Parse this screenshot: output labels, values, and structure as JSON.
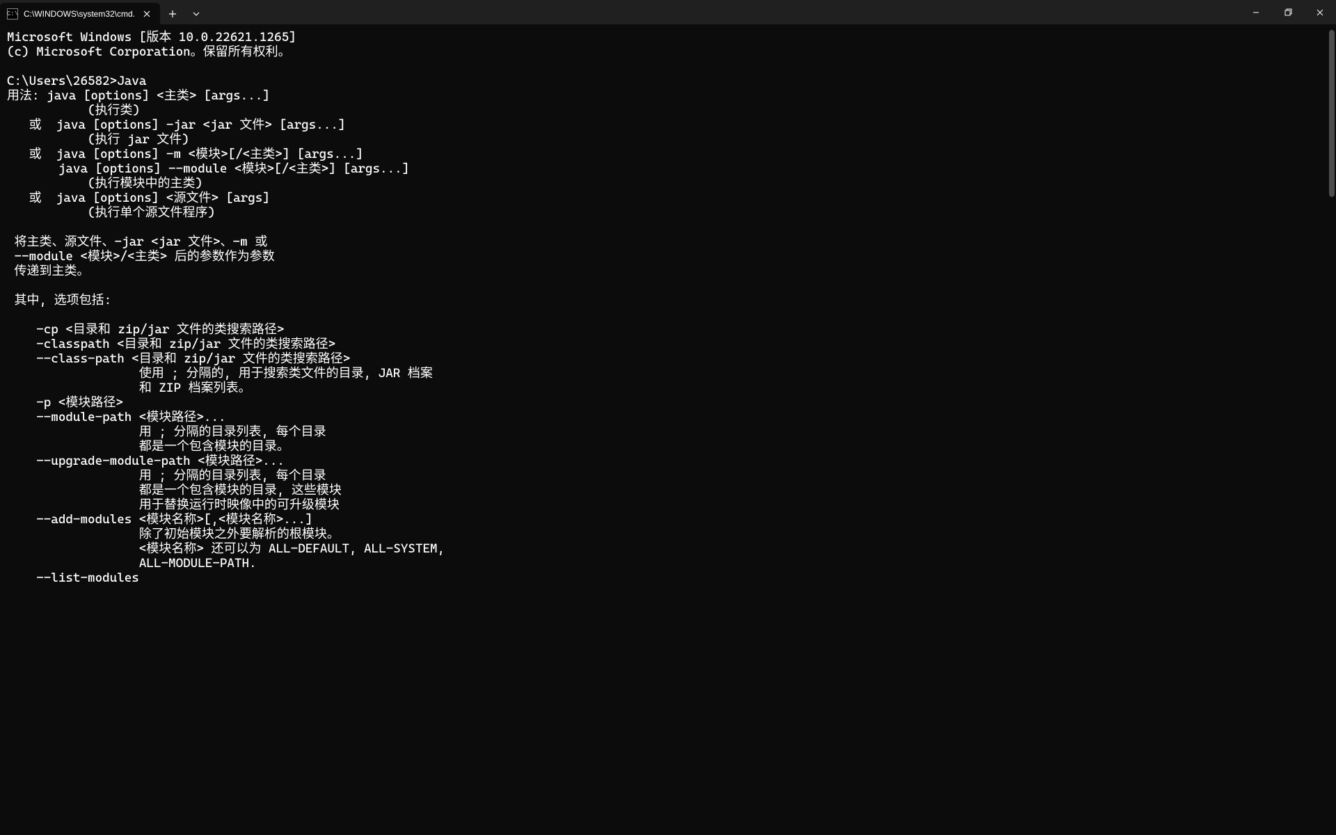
{
  "titlebar": {
    "tab_title": "C:\\WINDOWS\\system32\\cmd.",
    "cmd_icon_glyph": "C:\\"
  },
  "terminal": {
    "lines": [
      "Microsoft Windows [版本 10.0.22621.1265]",
      "(c) Microsoft Corporation。保留所有权利。",
      "",
      "C:\\Users\\26582>Java",
      "用法: java [options] <主类> [args...]",
      "           (执行类)",
      "   或  java [options] -jar <jar 文件> [args...]",
      "           (执行 jar 文件)",
      "   或  java [options] -m <模块>[/<主类>] [args...]",
      "       java [options] --module <模块>[/<主类>] [args...]",
      "           (执行模块中的主类)",
      "   或  java [options] <源文件> [args]",
      "           (执行单个源文件程序)",
      "",
      " 将主类、源文件、-jar <jar 文件>、-m 或",
      " --module <模块>/<主类> 后的参数作为参数",
      " 传递到主类。",
      "",
      " 其中, 选项包括:",
      "",
      "    -cp <目录和 zip/jar 文件的类搜索路径>",
      "    -classpath <目录和 zip/jar 文件的类搜索路径>",
      "    --class-path <目录和 zip/jar 文件的类搜索路径>",
      "                  使用 ; 分隔的, 用于搜索类文件的目录, JAR 档案",
      "                  和 ZIP 档案列表。",
      "    -p <模块路径>",
      "    --module-path <模块路径>...",
      "                  用 ; 分隔的目录列表, 每个目录",
      "                  都是一个包含模块的目录。",
      "    --upgrade-module-path <模块路径>...",
      "                  用 ; 分隔的目录列表, 每个目录",
      "                  都是一个包含模块的目录, 这些模块",
      "                  用于替换运行时映像中的可升级模块",
      "    --add-modules <模块名称>[,<模块名称>...]",
      "                  除了初始模块之外要解析的根模块。",
      "                  <模块名称> 还可以为 ALL-DEFAULT, ALL-SYSTEM,",
      "                  ALL-MODULE-PATH.",
      "    --list-modules"
    ]
  }
}
